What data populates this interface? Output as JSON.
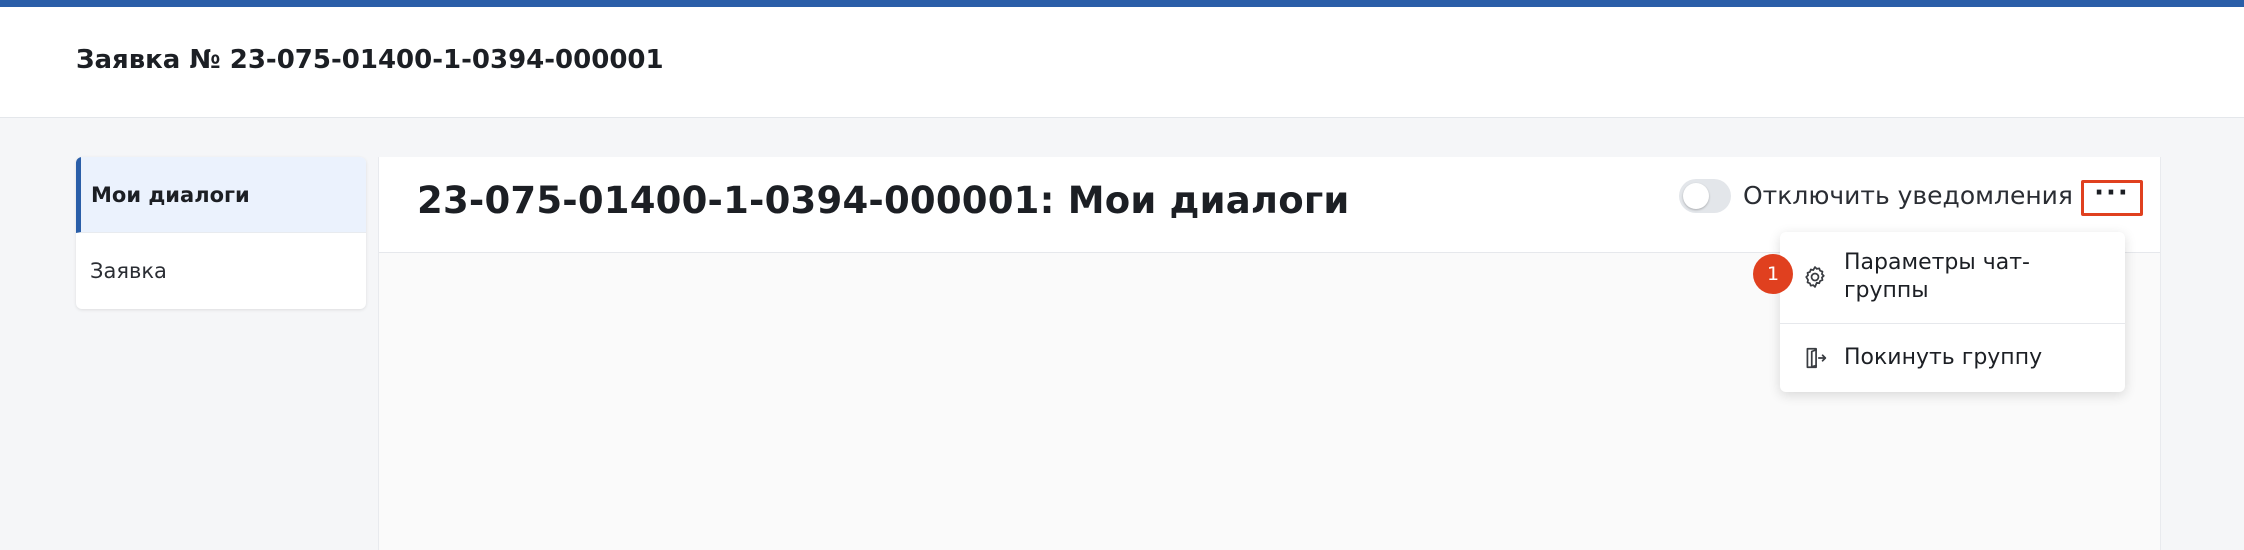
{
  "header": {
    "title": "Заявка № 23-075-01400-1-0394-000001"
  },
  "sidebar": {
    "items": [
      {
        "label": "Мои диалоги",
        "active": true
      },
      {
        "label": "Заявка",
        "active": false
      }
    ]
  },
  "panel": {
    "title": "23-075-01400-1-0394-000001: Мои диалоги",
    "notifications_toggle": {
      "label": "Отключить уведомления",
      "enabled": false
    },
    "more_button": {
      "glyph": "···",
      "icon": "more-horizontal-icon"
    }
  },
  "dropdown": {
    "items": [
      {
        "label": "Параметры чат-группы",
        "icon": "gear-icon"
      },
      {
        "label": "Покинуть группу",
        "icon": "exit-door-icon"
      }
    ]
  },
  "annotation": {
    "step": "1"
  },
  "colors": {
    "brand_blue": "#2a5ea8",
    "highlight_red": "#e0401f",
    "active_item_bg": "#ebf2fd"
  }
}
